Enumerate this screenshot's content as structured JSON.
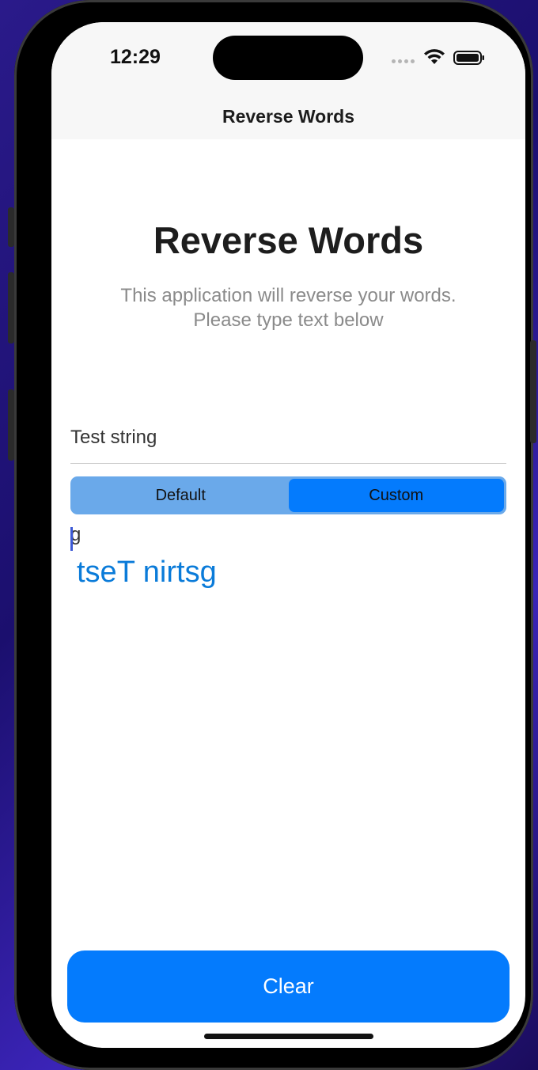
{
  "status_bar": {
    "time": "12:29",
    "icons": [
      "cellular-signal-icon",
      "wifi-icon",
      "battery-icon"
    ]
  },
  "navigation": {
    "title": "Reverse Words"
  },
  "main": {
    "heading": "Reverse Words",
    "subtitle_line1": "This application will reverse your words.",
    "subtitle_line2": "Please type text below",
    "input": {
      "value": "Test string",
      "placeholder": ""
    },
    "segmented_control": {
      "options": [
        "Default",
        "Custom"
      ],
      "selected": "Custom"
    },
    "custom_input_text": "g",
    "result_text": "tseT nirtsg",
    "clear_button_label": "Clear"
  },
  "colors": {
    "accent": "#047bfd",
    "segment_background": "#6aa9ea",
    "result_text": "#0a7bd9",
    "subtitle_text": "#8a8a8a"
  }
}
